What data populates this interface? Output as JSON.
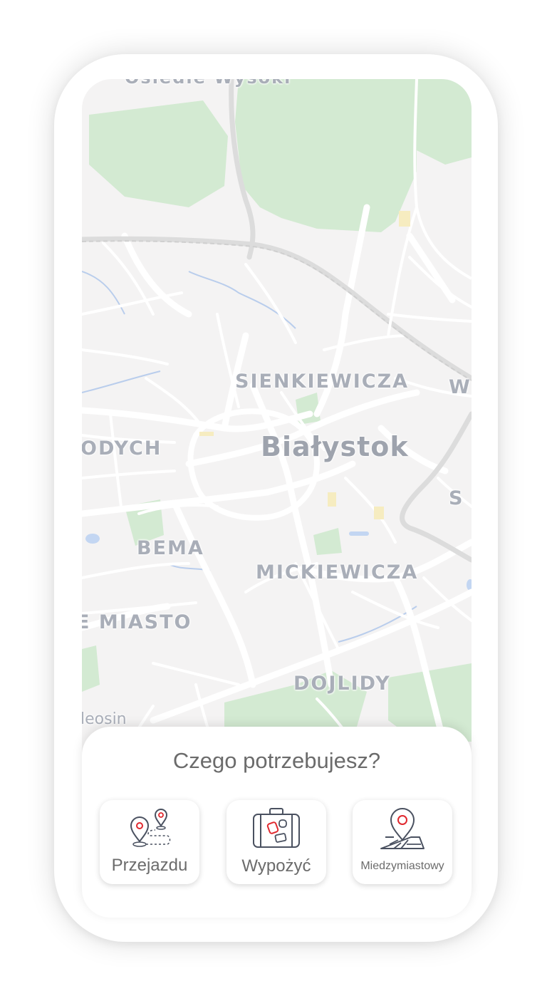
{
  "map": {
    "labels": {
      "top_cut": "Osiedle Wysoki",
      "sienkiewicza": "SIENKIEWICZA",
      "w_cut": "W",
      "city": "Białystok",
      "odych": "ODYCH",
      "s_cut": "S",
      "bema": "BEMA",
      "mickiewicza": "MICKIEWICZA",
      "miasto": "E MIASTO",
      "dojlidy": "DOJLIDY",
      "leosin": "leosin"
    }
  },
  "panel": {
    "title": "Czego potrzebujesz?",
    "options": [
      {
        "label": "Przejazdu",
        "icon": "route-pins-icon"
      },
      {
        "label": "Wypożyć",
        "icon": "suitcase-icon"
      },
      {
        "label": "Miedzymiastowy",
        "icon": "map-pin-icon"
      }
    ]
  },
  "colors": {
    "accent": "#e0282e",
    "icon_stroke": "#4a5160",
    "park": "#cfe8d0",
    "road": "#ffffff",
    "water": "#b9d0f0"
  }
}
